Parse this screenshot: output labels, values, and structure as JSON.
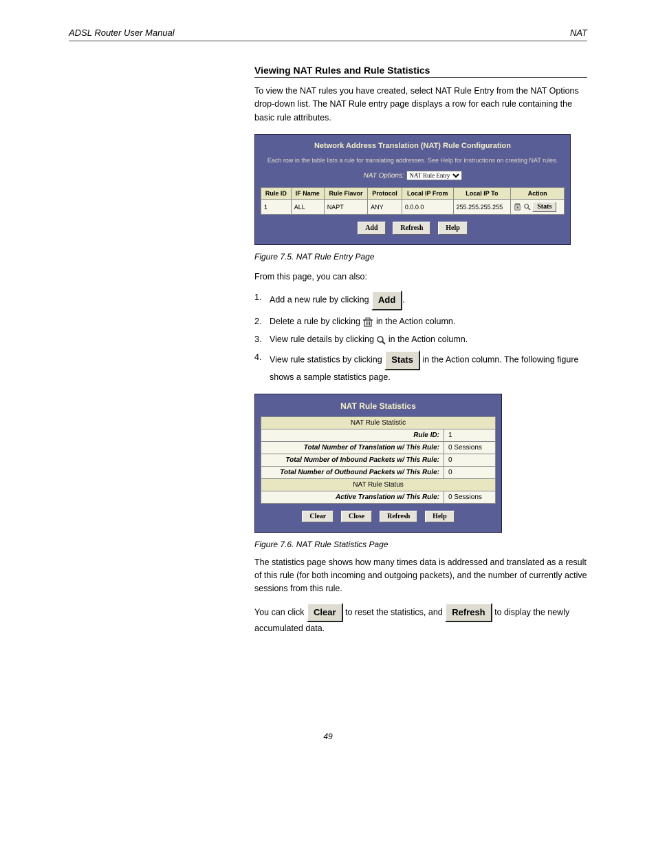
{
  "header": {
    "doc_title": "ADSL Router User Manual",
    "section": "NAT"
  },
  "section_heading": "Viewing NAT Rules and Rule Statistics",
  "intro": "To view the NAT rules you have created, select NAT Rule Entry from the NAT Options drop-down list. The NAT Rule entry page displays a row for each rule containing the basic rule attributes.",
  "panel1": {
    "title": "Network Address Translation (NAT) Rule Configuration",
    "desc": "Each row in the table lists a rule for translating addresses. See Help for instructions on creating NAT rules.",
    "opt_label": "NAT Options:",
    "opt_value": "NAT Rule Entry",
    "headers": [
      "Rule ID",
      "IF Name",
      "Rule Flavor",
      "Protocol",
      "Local IP From",
      "Local IP To",
      "Action"
    ],
    "row": {
      "rule_id": "1",
      "if_name": "ALL",
      "flavor": "NAPT",
      "protocol": "ANY",
      "from": "0.0.0.0",
      "to": "255.255.255.255",
      "stats_btn": "Stats"
    },
    "buttons": {
      "add": "Add",
      "refresh": "Refresh",
      "help": "Help"
    }
  },
  "caption1": "Figure 7.5. NAT Rule Entry Page",
  "list": {
    "line1": "From this page, you can also:",
    "rows": [
      {
        "n": "1.",
        "t_before": "Add a new rule by clicking ",
        "btn": "Add",
        "t_after": "."
      },
      {
        "n": "2.",
        "t_before": "Delete a rule by clicking ",
        "icon": "trash",
        "t_after": " in the Action column."
      },
      {
        "n": "3.",
        "t_before": "View rule details by clicking ",
        "icon": "mag",
        "t_after": " in the Action column."
      },
      {
        "n": "4.",
        "t_before": "View rule statistics by clicking ",
        "btn": "Stats",
        "t_after": " in the Action column. The following figure shows a sample statistics page."
      }
    ]
  },
  "panel2": {
    "title": "NAT Rule Statistics",
    "sub1": "NAT Rule Statistic",
    "rows1": [
      {
        "l": "Rule ID:",
        "v": "1"
      },
      {
        "l": "Total Number of Translation w/ This Rule:",
        "v": "0 Sessions"
      },
      {
        "l": "Total Number of Inbound Packets w/ This Rule:",
        "v": "0"
      },
      {
        "l": "Total Number of Outbound Packets w/ This Rule:",
        "v": "0"
      }
    ],
    "sub2": "NAT Rule Status",
    "rows2": [
      {
        "l": "Active Translation w/ This Rule:",
        "v": "0 Sessions"
      }
    ],
    "buttons": {
      "clear": "Clear",
      "close": "Close",
      "refresh": "Refresh",
      "help": "Help"
    }
  },
  "caption2": "Figure 7.6. NAT Rule Statistics Page",
  "body2": {
    "p1": "The statistics page shows how many times data is addressed and translated as a result of this rule (for both incoming and outgoing packets), and the number of currently active sessions from this rule.",
    "p2_before": "You can click ",
    "clear": "Clear",
    "p2_mid": " to reset the statistics, and ",
    "refresh": "Refresh",
    "p2_after": " to display the newly accumulated data."
  },
  "page_number": "49"
}
